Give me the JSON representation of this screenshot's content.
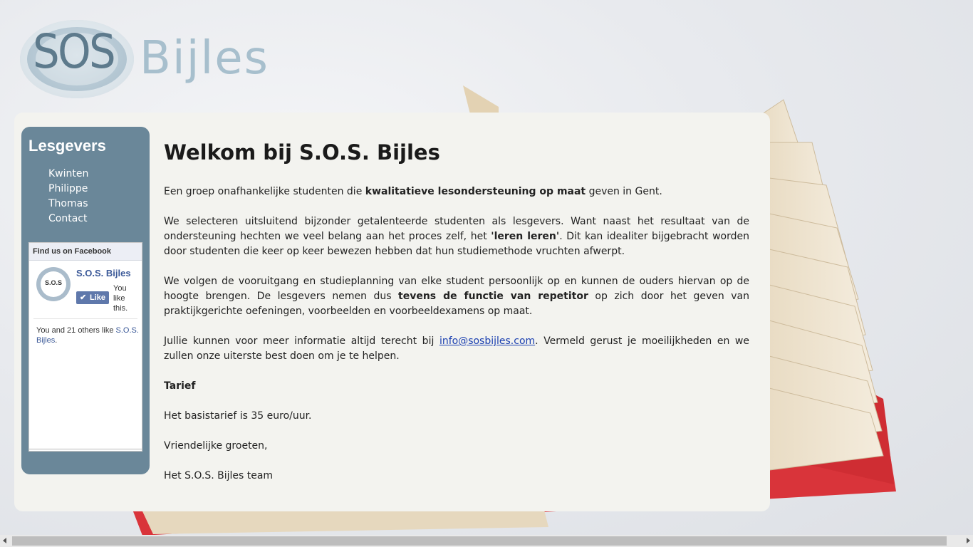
{
  "logo": {
    "part1": "SOS",
    "part2": "Bijles"
  },
  "sidebar": {
    "title": "Lesgevers",
    "items": [
      {
        "label": "Kwinten"
      },
      {
        "label": "Philippe"
      },
      {
        "label": "Thomas"
      },
      {
        "label": "Contact"
      }
    ]
  },
  "facebook": {
    "header": "Find us on Facebook",
    "avatar_text": "S.O.S",
    "page_name": "S.O.S. Bijles",
    "like_label": "Like",
    "you_like": "You like this.",
    "count_prefix": "You and 21 others like ",
    "count_link": "S.O.S. Bijles",
    "count_suffix": "."
  },
  "main": {
    "title": "Welkom bij S.O.S. Bijles",
    "p1_a": "Een groep onafhankelijke studenten die ",
    "p1_b": "kwalitatieve lesondersteuning op maat",
    "p1_c": " geven in Gent.",
    "p2_a": "We selecteren uitsluitend bijzonder getalenteerde studenten als lesgevers. Want naast het resultaat van de ondersteuning hechten we veel belang aan het proces zelf, het ",
    "p2_b": "'leren leren'",
    "p2_c": ". Dit kan idealiter bijgebracht worden door studenten die keer op keer bewezen hebben dat hun studiemethode vruchten afwerpt.",
    "p3_a": "We volgen de vooruitgang en studieplanning van elke student persoonlijk op en kunnen de ouders hiervan op de hoogte brengen. De lesgevers nemen dus ",
    "p3_b": "tevens de functie van repetitor",
    "p3_c": " op zich door het geven van praktijkgerichte oefeningen, voorbeelden en voorbeeldexamens op maat.",
    "p4_a": "Jullie kunnen voor meer informatie altijd terecht bij ",
    "p4_link": "info@sosbijles.com",
    "p4_c": ". Vermeld gerust je moeilijkheden en we zullen onze uiterste best doen om je te helpen.",
    "tarief_heading": "Tarief",
    "tarief_text": "Het basistarief is 35 euro/uur.",
    "greeting": "Vriendelijke groeten,",
    "signature": "Het S.O.S. Bijles team"
  },
  "colors": {
    "sidebar_bg": "#6a8799",
    "panel_bg": "#f3f3ef",
    "link": "#1a3fb0",
    "facebook_blue": "#3b5998"
  }
}
